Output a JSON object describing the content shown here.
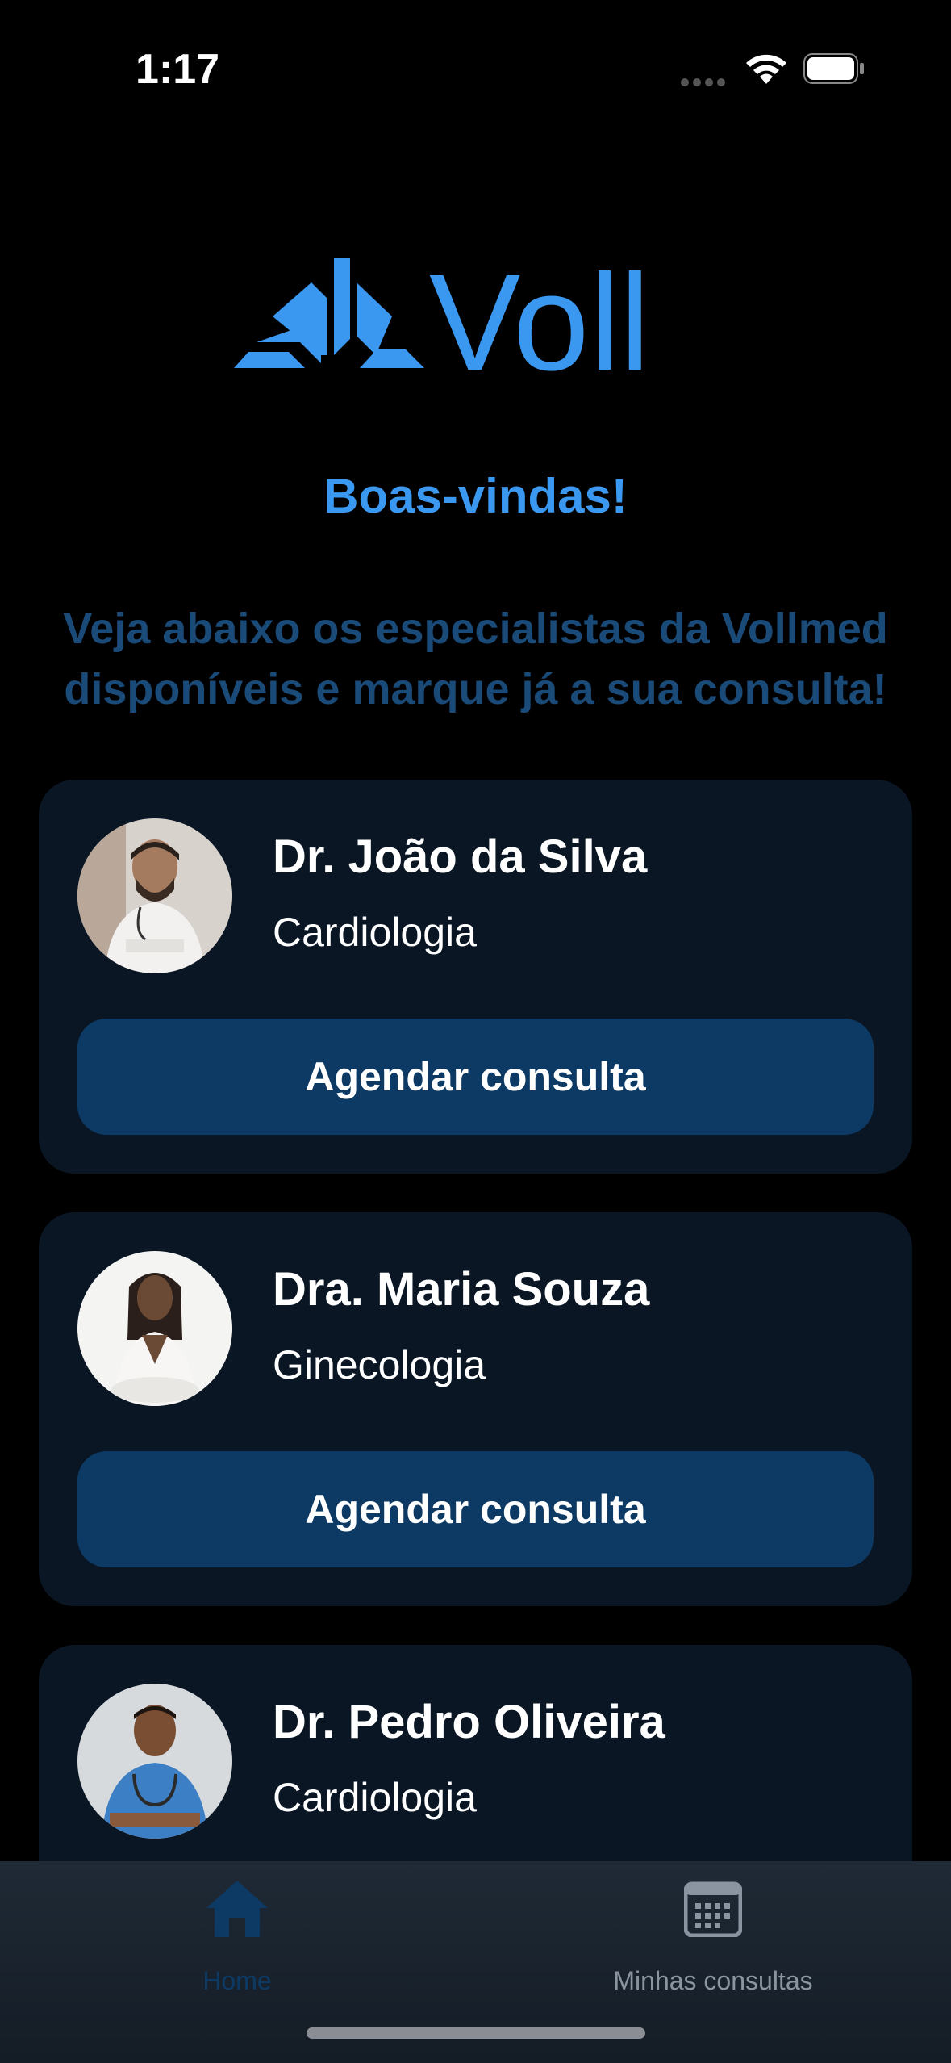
{
  "status_bar": {
    "time": "1:17"
  },
  "header": {
    "logo_text": "Voll",
    "welcome": "Boas-vindas!",
    "subtitle_line1": "Veja abaixo os especialistas da Vollmed",
    "subtitle_line2": "disponíveis e marque já a sua consulta!"
  },
  "doctors": [
    {
      "name": "Dr. João da Silva",
      "specialty": "Cardiologia",
      "button": "Agendar consulta"
    },
    {
      "name": "Dra. Maria Souza",
      "specialty": "Ginecologia",
      "button": "Agendar consulta"
    },
    {
      "name": "Dr. Pedro Oliveira",
      "specialty": "Cardiologia"
    }
  ],
  "tabbar": {
    "tabs": [
      {
        "label": "Home",
        "icon": "home-icon",
        "active": true
      },
      {
        "label": "Minhas consultas",
        "icon": "calendar-icon",
        "active": false
      }
    ]
  },
  "colors": {
    "accent": "#3a98f0",
    "subtitle": "#1a4a78",
    "card": "#0a1624",
    "button": "#0d3a64"
  }
}
